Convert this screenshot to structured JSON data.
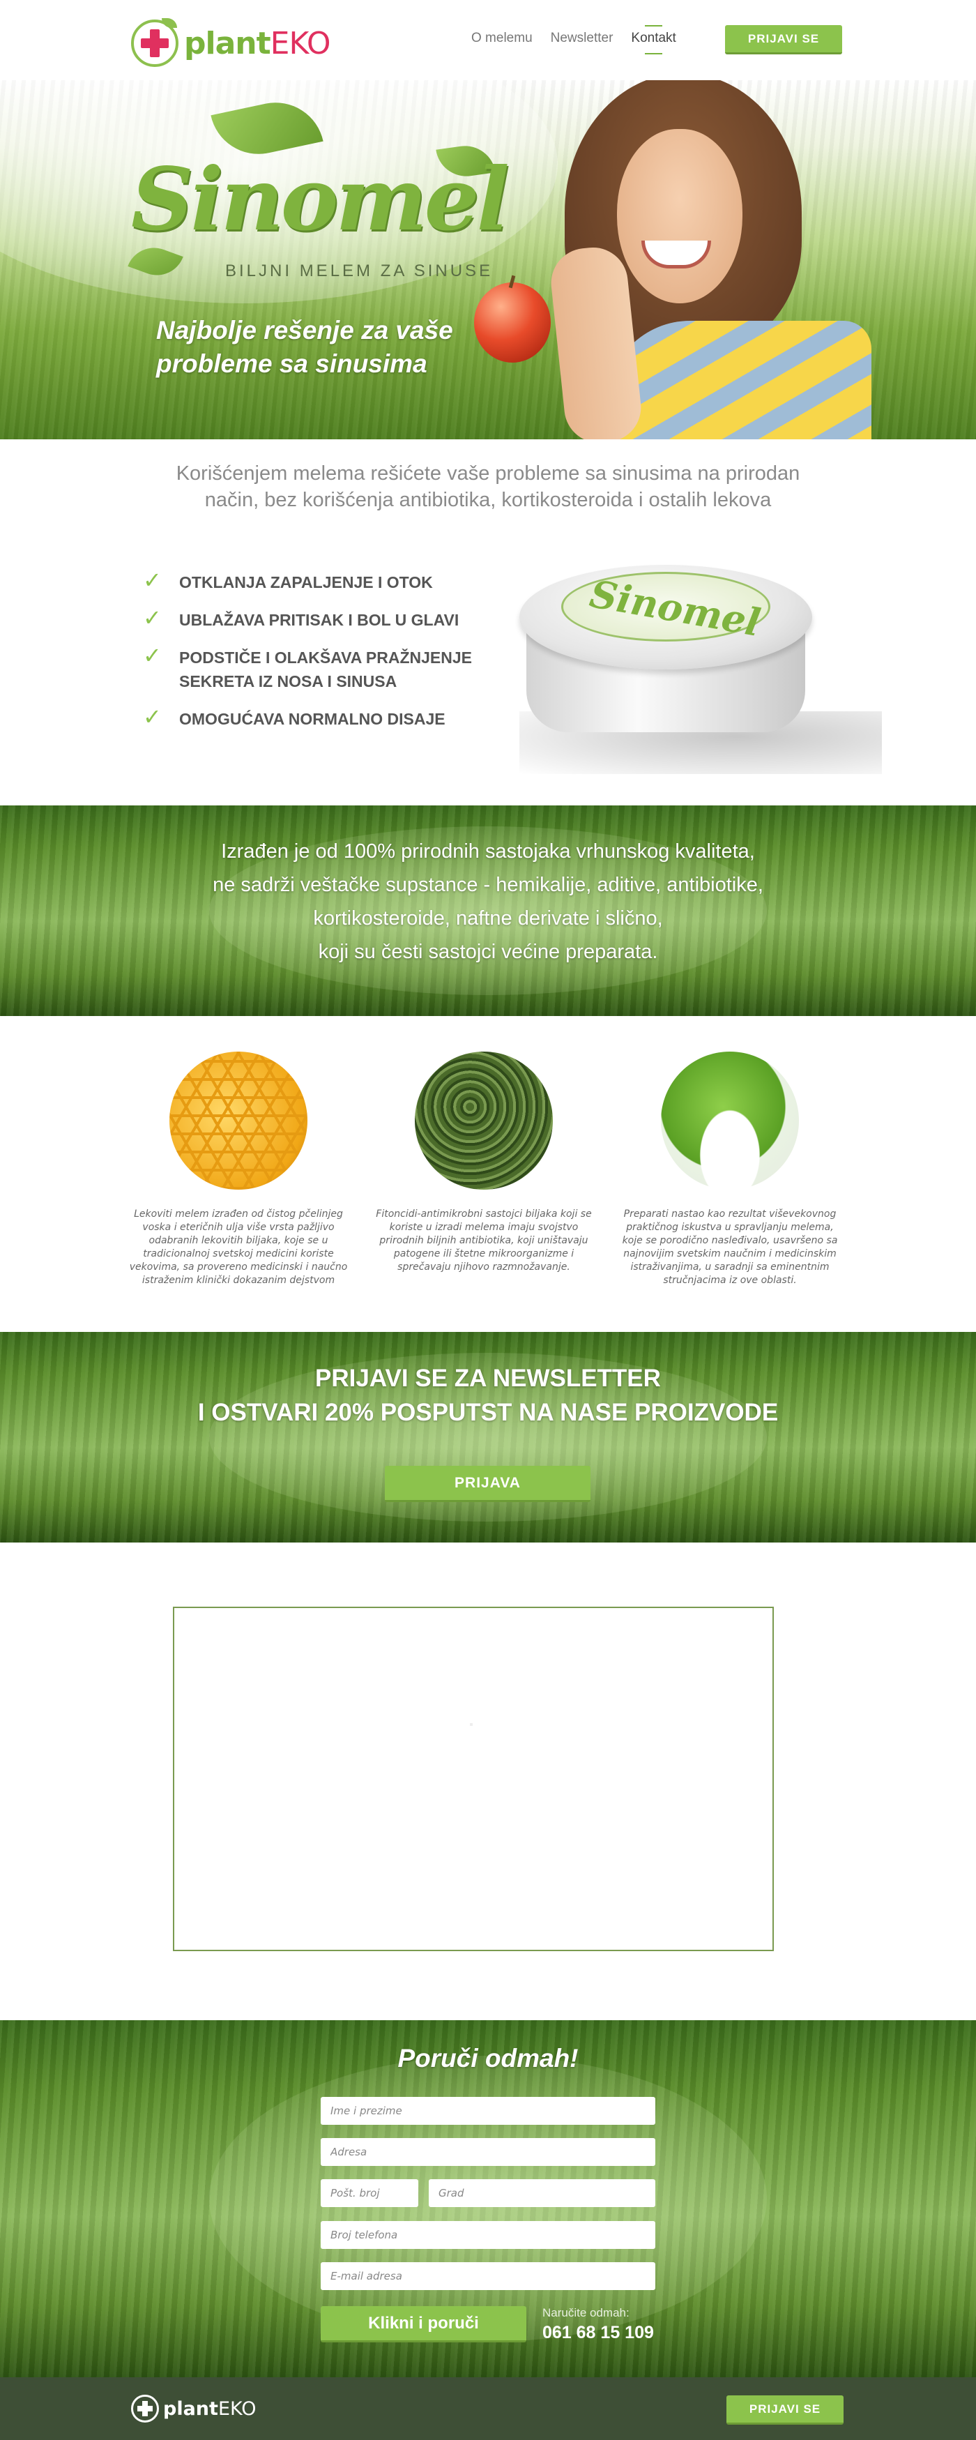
{
  "header": {
    "logo_plant": "plant",
    "logo_eko": "EKO",
    "nav": [
      "O melemu",
      "Newsletter",
      "Kontakt"
    ],
    "cta_label": "PRIJAVI SE"
  },
  "hero": {
    "brand_word": "Sinomel",
    "brand_sub": "BILJNI MELEM ZA SINUSE",
    "title_line1": "Najbolje rešenje za vaše",
    "title_line2": "probleme sa sinusima"
  },
  "intro": {
    "line1": "Korišćenjem melema rešićete vaše probleme sa sinusima na prirodan",
    "line2": "način, bez korišćenja antibiotika, kortikosteroida i ostalih lekova"
  },
  "features": [
    "OTKLANJA ZAPALJENJE I OTOK",
    "UBLAŽAVA PRITISAK I BOL U GLAVI",
    "PODSTIČE I OLAKŠAVA PRAŽNJENJE SEKRETA IZ NOSA I SINUSA",
    "OMOGUĆAVA NORMALNO DISAJE"
  ],
  "jar": {
    "label_word": "Sinomel"
  },
  "banner1": {
    "line1": "Izrađen je od 100% prirodnih sastojaka vrhunskog kvaliteta,",
    "line2": "ne sadrži veštačke supstance - hemikalije, aditive, antibiotike,",
    "line3": "kortikosteroide, naftne derivate i slično,",
    "line4": "koji su česti sastojci većine preparata."
  },
  "ingredients": [
    {
      "icon": "honeycomb-image",
      "caption": "Lekoviti melem izrađen od čistog pčelinjeg voska i eteričnih ulja više vrsta pažljivo odabranih lekovitih biljaka, koje se u tradicionalnoj svetskoj medicini koriste vekovima, sa provereno medicinski i naučno istraženim klinički dokazanim dejstvom"
    },
    {
      "icon": "herbs-image",
      "caption": "Fitoncidi-antimikrobni sastojci biljaka koji se koriste u izradi melema imaju svojstvo prirodnih biljnih antibiotika, koji uništavaju patogene ili štetne mikroorganizme i sprečavaju njihovo razmnožavanje."
    },
    {
      "icon": "mortar-herbs-image",
      "caption": "Preparati nastao kao rezultat viševekovnog praktičnog iskustva u spravljanju melema, koje se porodično nasleđivalo, usavršeno sa najnovijim svetskim naučnim i medicinskim istraživanjima, u saradnji sa eminentnim stručnjacima iz ove oblasti."
    }
  ],
  "newsletter": {
    "line1": "PRIJAVI SE ZA NEWSLETTER",
    "line2": "I OSTVARI 20% POSPUTST NA NASE PROIZVODE",
    "button": "PRIJAVA"
  },
  "order": {
    "title": "Poruči odmah!",
    "fields": {
      "name": "Ime i prezime",
      "address": "Adresa",
      "zip": "Pošt. broj",
      "city": "Grad",
      "phone": "Broj telefona",
      "email": "E-mail adresa"
    },
    "button": "Klikni i poruči",
    "call_label": "Naručite odmah:",
    "call_number": "061 68 15 109"
  },
  "footer": {
    "logo_plant": "plant",
    "logo_eko": "EKO",
    "cta_label": "PRIJAVI SE"
  }
}
